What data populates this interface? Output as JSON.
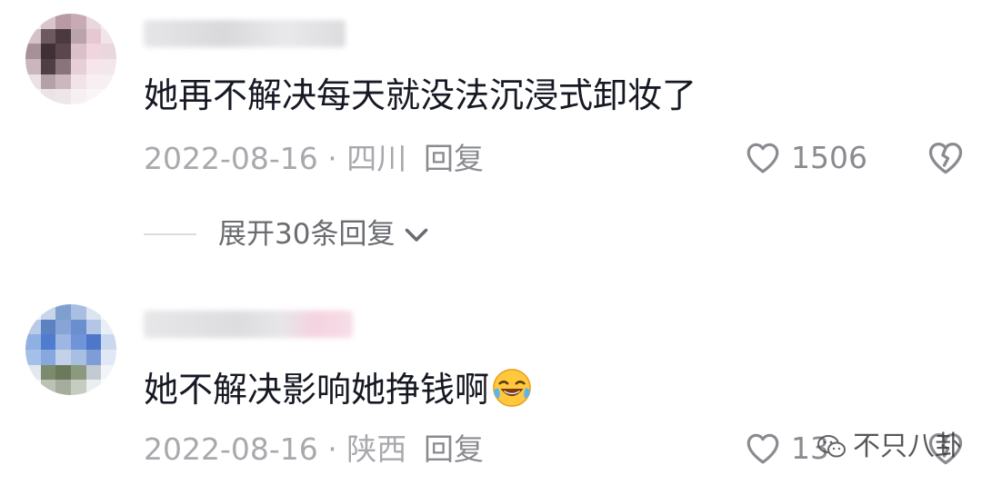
{
  "comments": [
    {
      "text": "她再不解决每天就没法沉浸式卸妆了",
      "date": "2022-08-16",
      "separator": "·",
      "location": "四川",
      "reply_label": "回复",
      "like_count": "1506",
      "expand_replies_label": "展开30条回复"
    },
    {
      "text": "她不解决影响她挣钱啊",
      "date": "2022-08-16",
      "separator": "·",
      "location": "陕西",
      "reply_label": "回复",
      "like_count": "13"
    }
  ],
  "watermark": {
    "text": "不只八卦"
  },
  "colors": {
    "text": "#161823",
    "meta": "#a8a9ad",
    "secondary": "#8a8b90"
  }
}
